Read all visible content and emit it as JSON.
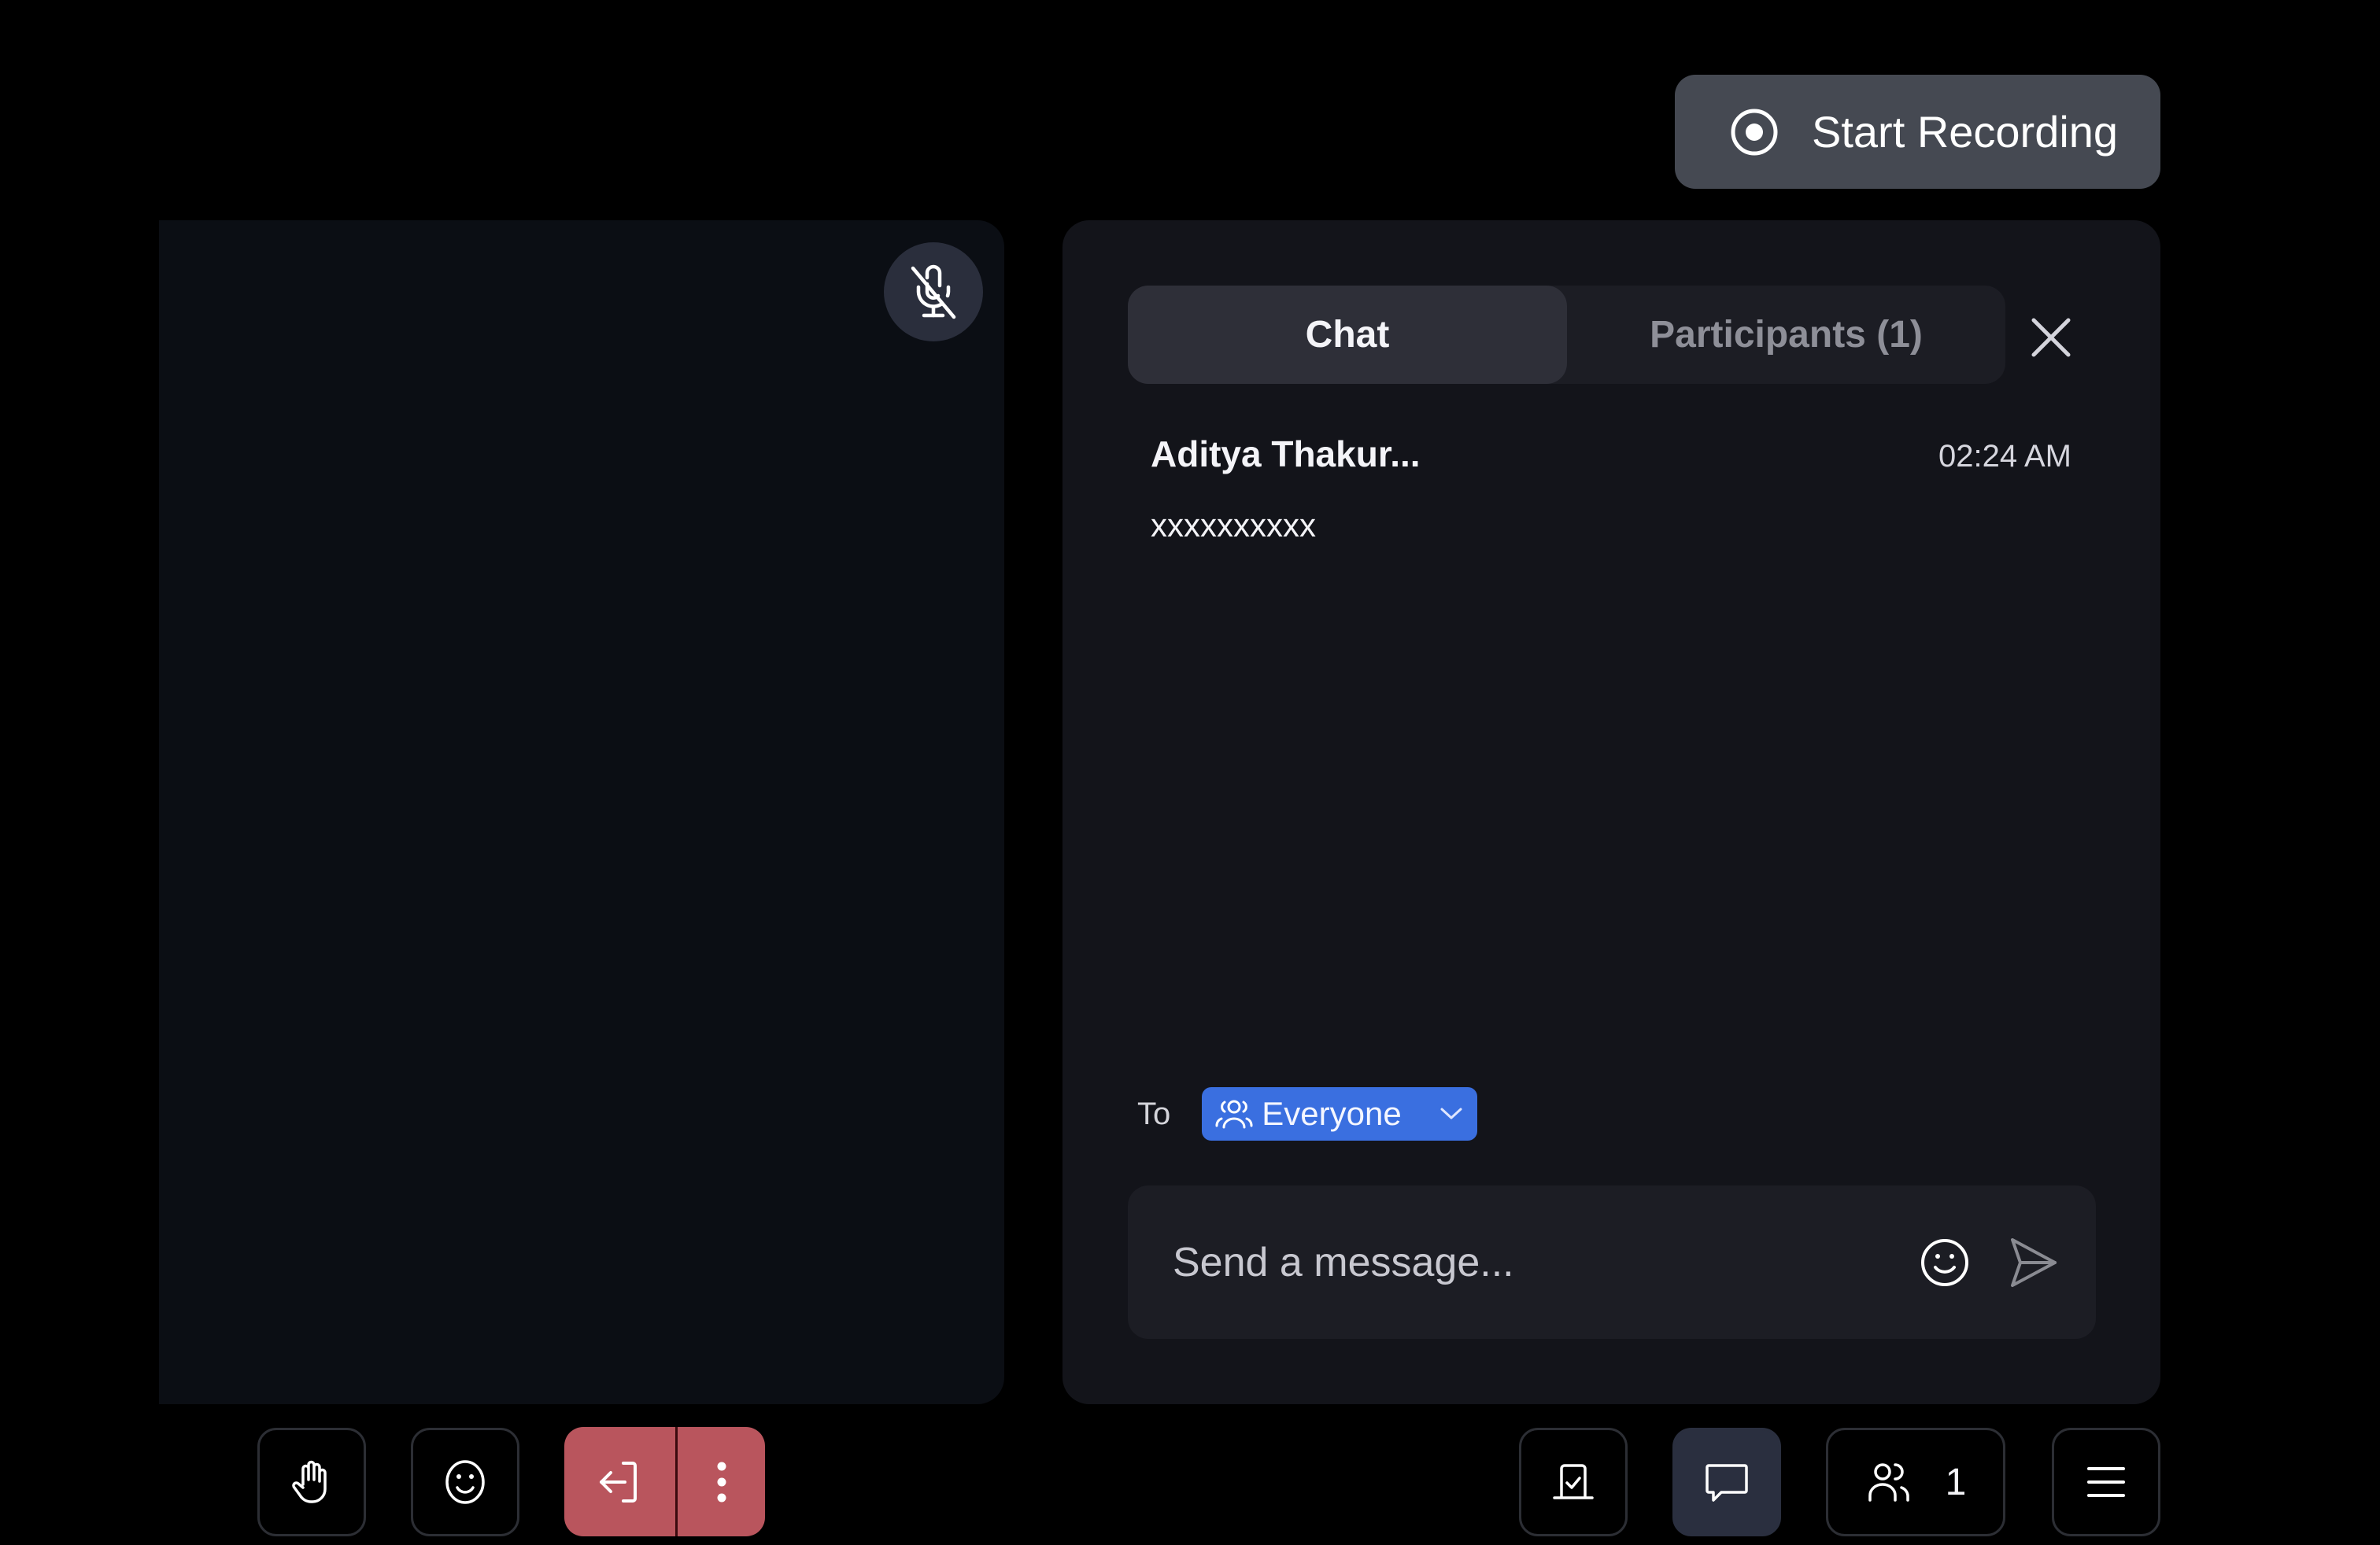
{
  "recording": {
    "label": "Start Recording",
    "icon": "record-icon"
  },
  "video_tile": {
    "mic_status": "muted",
    "mic_icon": "mic-off-icon"
  },
  "chat_panel": {
    "tabs": [
      {
        "label": "Chat",
        "active": true
      },
      {
        "label": "Participants (1)",
        "active": false
      }
    ],
    "close_icon": "close-icon",
    "messages": [
      {
        "sender": "Aditya Thakur...",
        "time": "02:24 AM",
        "text": "xxxxxxxxxx"
      }
    ],
    "to_label": "To",
    "recipient": {
      "value": "Everyone",
      "icon": "people-icon"
    },
    "composer": {
      "placeholder": "Send a message...",
      "value": "",
      "emoji_icon": "emoji-icon",
      "send_icon": "send-icon"
    }
  },
  "toolbar": {
    "left": [
      {
        "name": "raise-hand",
        "icon": "hand-icon"
      },
      {
        "name": "reactions",
        "icon": "emoji-icon"
      },
      {
        "name": "leave",
        "icon": "leave-icon"
      },
      {
        "name": "leave-options",
        "icon": "more-vertical-icon"
      }
    ],
    "right": [
      {
        "name": "whiteboard",
        "icon": "whiteboard-icon"
      },
      {
        "name": "chat",
        "icon": "chat-icon",
        "active": true
      },
      {
        "name": "participants",
        "icon": "people-icon",
        "count": "1"
      },
      {
        "name": "menu",
        "icon": "menu-icon"
      }
    ]
  },
  "colors": {
    "background": "#000000",
    "panel": "#13141a",
    "video_tile": "#0b0e14",
    "accent_blue": "#3a6fe0",
    "leave_red": "#b9555d",
    "record_button": "#454952",
    "active_toolbar": "#2a2f3f"
  }
}
